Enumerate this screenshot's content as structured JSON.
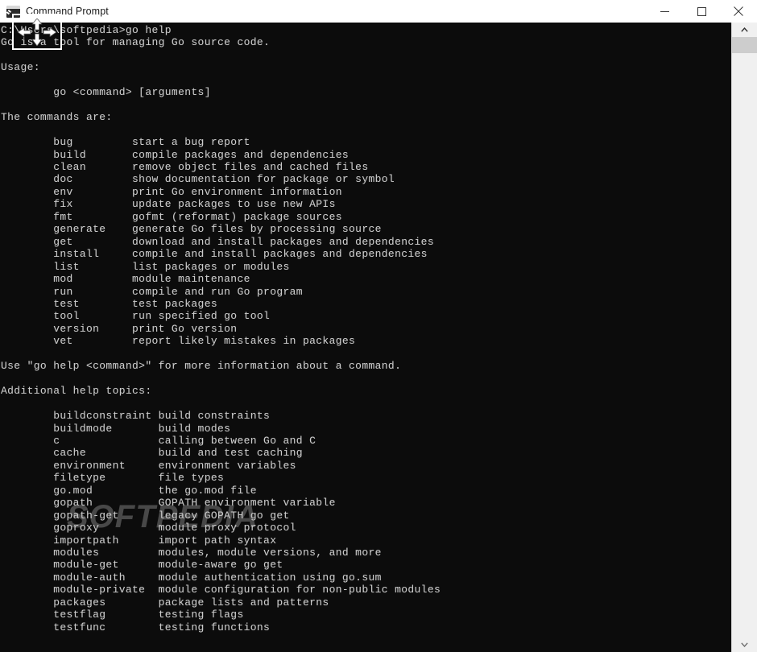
{
  "window": {
    "title": "Command Prompt",
    "icon": "command-prompt-icon",
    "background_color": "#0c0c0c",
    "text_color": "#cccccc",
    "titlebar_color": "#ffffff"
  },
  "titlebar_buttons": {
    "minimize_label": "—",
    "maximize_label": "☐",
    "close_label": "✕"
  },
  "scrollbar": {
    "up_arrow": "∧",
    "down_arrow": "∨",
    "thumb_position_percent": 0
  },
  "overlay": {
    "cursor_name": "move-cursor",
    "watermark_text": "SOFTPEDIA"
  },
  "terminal": {
    "prompt_path": "C:\\Users\\softpedia",
    "prompt_symbol": ">",
    "command": "go help",
    "tagline": "Go is a tool for managing Go source code.",
    "usage_heading": "Usage:",
    "usage_line": "go <command> [arguments]",
    "commands_heading": "The commands are:",
    "commands": [
      {
        "name": "bug",
        "description": "start a bug report"
      },
      {
        "name": "build",
        "description": "compile packages and dependencies"
      },
      {
        "name": "clean",
        "description": "remove object files and cached files"
      },
      {
        "name": "doc",
        "description": "show documentation for package or symbol"
      },
      {
        "name": "env",
        "description": "print Go environment information"
      },
      {
        "name": "fix",
        "description": "update packages to use new APIs"
      },
      {
        "name": "fmt",
        "description": "gofmt (reformat) package sources"
      },
      {
        "name": "generate",
        "description": "generate Go files by processing source"
      },
      {
        "name": "get",
        "description": "download and install packages and dependencies"
      },
      {
        "name": "install",
        "description": "compile and install packages and dependencies"
      },
      {
        "name": "list",
        "description": "list packages or modules"
      },
      {
        "name": "mod",
        "description": "module maintenance"
      },
      {
        "name": "run",
        "description": "compile and run Go program"
      },
      {
        "name": "test",
        "description": "test packages"
      },
      {
        "name": "tool",
        "description": "run specified go tool"
      },
      {
        "name": "version",
        "description": "print Go version"
      },
      {
        "name": "vet",
        "description": "report likely mistakes in packages"
      }
    ],
    "help_hint": "Use \"go help <command>\" for more information about a command.",
    "topics_heading": "Additional help topics:",
    "topics": [
      {
        "name": "buildconstraint",
        "description": "build constraints"
      },
      {
        "name": "buildmode",
        "description": "build modes"
      },
      {
        "name": "c",
        "description": "calling between Go and C"
      },
      {
        "name": "cache",
        "description": "build and test caching"
      },
      {
        "name": "environment",
        "description": "environment variables"
      },
      {
        "name": "filetype",
        "description": "file types"
      },
      {
        "name": "go.mod",
        "description": "the go.mod file"
      },
      {
        "name": "gopath",
        "description": "GOPATH environment variable"
      },
      {
        "name": "gopath-get",
        "description": "legacy GOPATH go get"
      },
      {
        "name": "goproxy",
        "description": "module proxy protocol"
      },
      {
        "name": "importpath",
        "description": "import path syntax"
      },
      {
        "name": "modules",
        "description": "modules, module versions, and more"
      },
      {
        "name": "module-get",
        "description": "module-aware go get"
      },
      {
        "name": "module-auth",
        "description": "module authentication using go.sum"
      },
      {
        "name": "module-private",
        "description": "module configuration for non-public modules"
      },
      {
        "name": "packages",
        "description": "package lists and patterns"
      },
      {
        "name": "testflag",
        "description": "testing flags"
      },
      {
        "name": "testfunc",
        "description": "testing functions"
      }
    ]
  }
}
